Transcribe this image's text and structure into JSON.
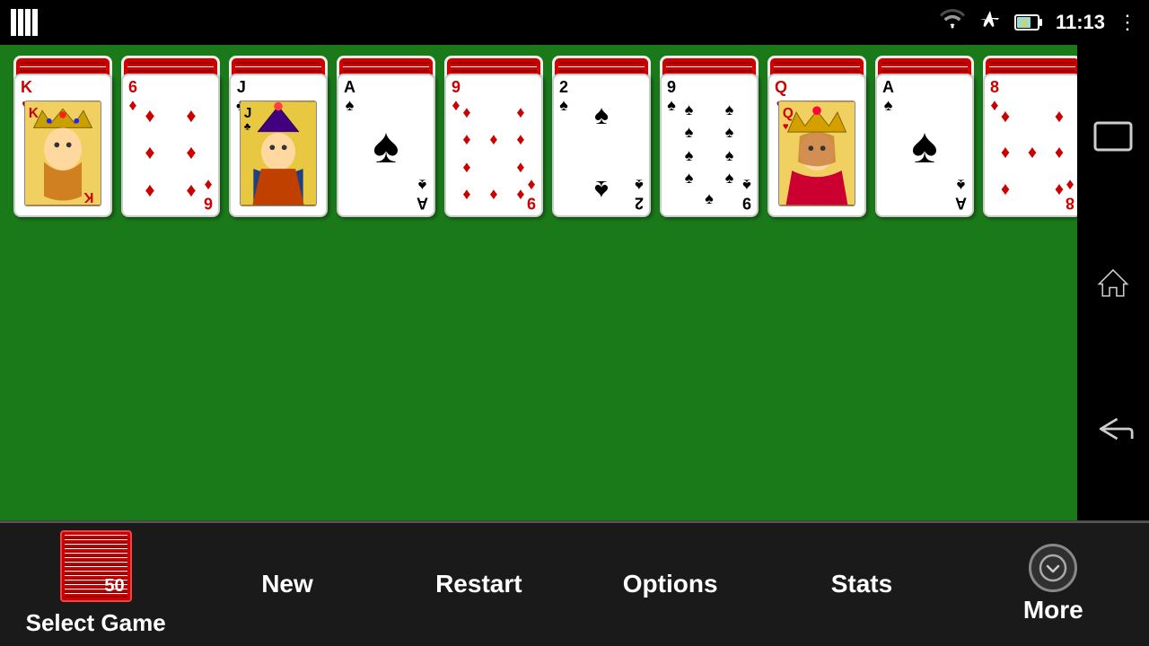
{
  "statusBar": {
    "time": "11:13"
  },
  "game": {
    "gameNumber": "50",
    "cards": [
      {
        "id": "col1",
        "rank": "K",
        "suit": "♥",
        "color": "red",
        "type": "face",
        "faceType": "king-hearts",
        "backCount": 6
      },
      {
        "id": "col2",
        "rank": "6",
        "suit": "♦",
        "color": "red",
        "type": "pip",
        "backCount": 5
      },
      {
        "id": "col3",
        "rank": "J",
        "suit": "♣",
        "color": "black",
        "type": "face",
        "faceType": "jack-clubs",
        "backCount": 5
      },
      {
        "id": "col4",
        "rank": "A",
        "suit": "♠",
        "color": "black",
        "type": "ace",
        "backCount": 4
      },
      {
        "id": "col5",
        "rank": "9",
        "suit": "♦",
        "color": "red",
        "type": "nine-diamonds",
        "backCount": 4
      },
      {
        "id": "col6",
        "rank": "2",
        "suit": "♠",
        "color": "black",
        "type": "two-spades",
        "backCount": 4
      },
      {
        "id": "col7",
        "rank": "9",
        "suit": "♠",
        "color": "black",
        "type": "nine-spades",
        "backCount": 3
      },
      {
        "id": "col8",
        "rank": "Q",
        "suit": "♥",
        "color": "red",
        "type": "face",
        "faceType": "queen-hearts",
        "backCount": 3
      },
      {
        "id": "col9",
        "rank": "A",
        "suit": "♠",
        "color": "black",
        "type": "ace",
        "backCount": 3
      },
      {
        "id": "col10",
        "rank": "8",
        "suit": "♦",
        "color": "red",
        "type": "eight-diamonds",
        "backCount": 3
      }
    ]
  },
  "bottomBar": {
    "selectGame": "Select Game",
    "selectGameNumber": "50",
    "newGame": "New",
    "restart": "Restart",
    "options": "Options",
    "stats": "Stats",
    "more": "More"
  },
  "rightNav": {
    "landscape": "⬜",
    "home": "⌂",
    "back": "←"
  }
}
